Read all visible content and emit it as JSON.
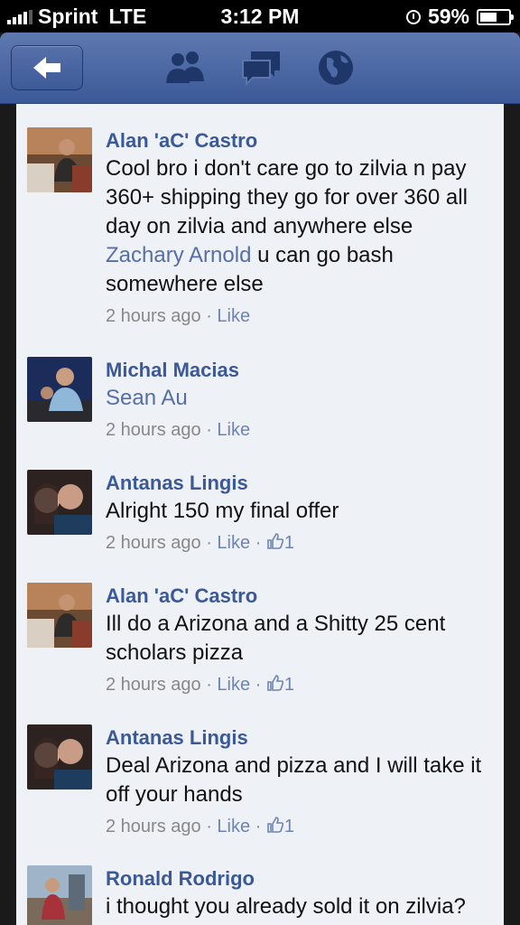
{
  "status_bar": {
    "carrier": "Sprint",
    "network": "LTE",
    "time": "3:12 PM",
    "battery": "59%"
  },
  "navbar": {
    "icons": [
      "back-arrow-icon",
      "friend-requests-icon",
      "messages-icon",
      "notifications-globe-icon"
    ]
  },
  "colors": {
    "nav_top": "#5f79b0",
    "nav_bottom": "#3b5998",
    "name": "#3b5998",
    "link": "#6d84b4",
    "background": "#eef1f6"
  },
  "comments": [
    {
      "name": "Alan 'aC' Castro",
      "text_before": "Cool bro i don't care go to zilvia n pay 360+ shipping they go for over 360 all day on zilvia and anywhere else ",
      "tag": "Zachary Arnold",
      "text_after": " u can go bash somewhere else",
      "time": "2 hours ago",
      "like": "Like",
      "likes": ""
    },
    {
      "name": "Michal Macias",
      "text_before": "",
      "tag": "Sean Au",
      "text_after": "",
      "time": "2 hours ago",
      "like": "Like",
      "likes": ""
    },
    {
      "name": "Antanas Lingis",
      "text_before": "Alright 150 my final offer",
      "tag": "",
      "text_after": "",
      "time": "2 hours ago",
      "like": "Like",
      "likes": "1"
    },
    {
      "name": "Alan 'aC' Castro",
      "text_before": "Ill do a Arizona and a Shitty 25 cent scholars pizza",
      "tag": "",
      "text_after": "",
      "time": "2 hours ago",
      "like": "Like",
      "likes": "1"
    },
    {
      "name": "Antanas Lingis",
      "text_before": "Deal Arizona and pizza and I will take it off your hands",
      "tag": "",
      "text_after": "",
      "time": "2 hours ago",
      "like": "Like",
      "likes": "1"
    },
    {
      "name": "Ronald Rodrigo",
      "text_before": "i thought you already sold it on zilvia?",
      "tag": "",
      "text_after": "",
      "time": "",
      "like": "",
      "likes": ""
    }
  ]
}
